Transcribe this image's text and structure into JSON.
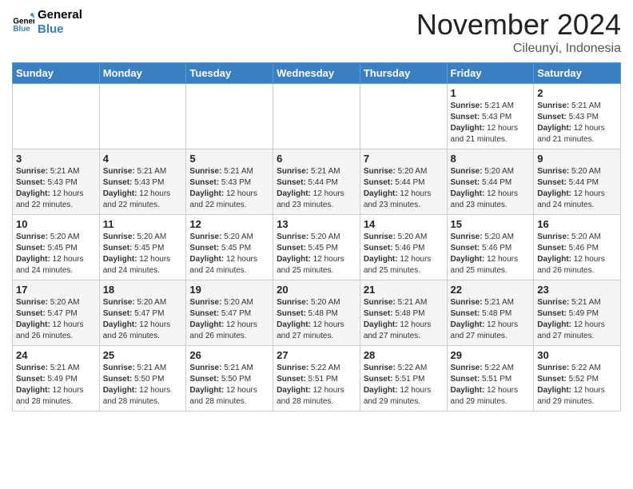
{
  "logo": {
    "line1": "General",
    "line2": "Blue"
  },
  "title": "November 2024",
  "location": "Cileunyi, Indonesia",
  "weekdays": [
    "Sunday",
    "Monday",
    "Tuesday",
    "Wednesday",
    "Thursday",
    "Friday",
    "Saturday"
  ],
  "weeks": [
    [
      {
        "day": "",
        "sunrise": "",
        "sunset": "",
        "daylight": ""
      },
      {
        "day": "",
        "sunrise": "",
        "sunset": "",
        "daylight": ""
      },
      {
        "day": "",
        "sunrise": "",
        "sunset": "",
        "daylight": ""
      },
      {
        "day": "",
        "sunrise": "",
        "sunset": "",
        "daylight": ""
      },
      {
        "day": "",
        "sunrise": "",
        "sunset": "",
        "daylight": ""
      },
      {
        "day": "1",
        "sunrise": "5:21 AM",
        "sunset": "5:43 PM",
        "daylight": "12 hours and 21 minutes."
      },
      {
        "day": "2",
        "sunrise": "5:21 AM",
        "sunset": "5:43 PM",
        "daylight": "12 hours and 21 minutes."
      }
    ],
    [
      {
        "day": "3",
        "sunrise": "5:21 AM",
        "sunset": "5:43 PM",
        "daylight": "12 hours and 22 minutes."
      },
      {
        "day": "4",
        "sunrise": "5:21 AM",
        "sunset": "5:43 PM",
        "daylight": "12 hours and 22 minutes."
      },
      {
        "day": "5",
        "sunrise": "5:21 AM",
        "sunset": "5:43 PM",
        "daylight": "12 hours and 22 minutes."
      },
      {
        "day": "6",
        "sunrise": "5:21 AM",
        "sunset": "5:44 PM",
        "daylight": "12 hours and 23 minutes."
      },
      {
        "day": "7",
        "sunrise": "5:20 AM",
        "sunset": "5:44 PM",
        "daylight": "12 hours and 23 minutes."
      },
      {
        "day": "8",
        "sunrise": "5:20 AM",
        "sunset": "5:44 PM",
        "daylight": "12 hours and 23 minutes."
      },
      {
        "day": "9",
        "sunrise": "5:20 AM",
        "sunset": "5:44 PM",
        "daylight": "12 hours and 24 minutes."
      }
    ],
    [
      {
        "day": "10",
        "sunrise": "5:20 AM",
        "sunset": "5:45 PM",
        "daylight": "12 hours and 24 minutes."
      },
      {
        "day": "11",
        "sunrise": "5:20 AM",
        "sunset": "5:45 PM",
        "daylight": "12 hours and 24 minutes."
      },
      {
        "day": "12",
        "sunrise": "5:20 AM",
        "sunset": "5:45 PM",
        "daylight": "12 hours and 24 minutes."
      },
      {
        "day": "13",
        "sunrise": "5:20 AM",
        "sunset": "5:45 PM",
        "daylight": "12 hours and 25 minutes."
      },
      {
        "day": "14",
        "sunrise": "5:20 AM",
        "sunset": "5:46 PM",
        "daylight": "12 hours and 25 minutes."
      },
      {
        "day": "15",
        "sunrise": "5:20 AM",
        "sunset": "5:46 PM",
        "daylight": "12 hours and 25 minutes."
      },
      {
        "day": "16",
        "sunrise": "5:20 AM",
        "sunset": "5:46 PM",
        "daylight": "12 hours and 26 minutes."
      }
    ],
    [
      {
        "day": "17",
        "sunrise": "5:20 AM",
        "sunset": "5:47 PM",
        "daylight": "12 hours and 26 minutes."
      },
      {
        "day": "18",
        "sunrise": "5:20 AM",
        "sunset": "5:47 PM",
        "daylight": "12 hours and 26 minutes."
      },
      {
        "day": "19",
        "sunrise": "5:20 AM",
        "sunset": "5:47 PM",
        "daylight": "12 hours and 26 minutes."
      },
      {
        "day": "20",
        "sunrise": "5:20 AM",
        "sunset": "5:48 PM",
        "daylight": "12 hours and 27 minutes."
      },
      {
        "day": "21",
        "sunrise": "5:21 AM",
        "sunset": "5:48 PM",
        "daylight": "12 hours and 27 minutes."
      },
      {
        "day": "22",
        "sunrise": "5:21 AM",
        "sunset": "5:48 PM",
        "daylight": "12 hours and 27 minutes."
      },
      {
        "day": "23",
        "sunrise": "5:21 AM",
        "sunset": "5:49 PM",
        "daylight": "12 hours and 27 minutes."
      }
    ],
    [
      {
        "day": "24",
        "sunrise": "5:21 AM",
        "sunset": "5:49 PM",
        "daylight": "12 hours and 28 minutes."
      },
      {
        "day": "25",
        "sunrise": "5:21 AM",
        "sunset": "5:50 PM",
        "daylight": "12 hours and 28 minutes."
      },
      {
        "day": "26",
        "sunrise": "5:21 AM",
        "sunset": "5:50 PM",
        "daylight": "12 hours and 28 minutes."
      },
      {
        "day": "27",
        "sunrise": "5:22 AM",
        "sunset": "5:51 PM",
        "daylight": "12 hours and 28 minutes."
      },
      {
        "day": "28",
        "sunrise": "5:22 AM",
        "sunset": "5:51 PM",
        "daylight": "12 hours and 29 minutes."
      },
      {
        "day": "29",
        "sunrise": "5:22 AM",
        "sunset": "5:51 PM",
        "daylight": "12 hours and 29 minutes."
      },
      {
        "day": "30",
        "sunrise": "5:22 AM",
        "sunset": "5:52 PM",
        "daylight": "12 hours and 29 minutes."
      }
    ]
  ],
  "labels": {
    "sunrise": "Sunrise:",
    "sunset": "Sunset:",
    "daylight": "Daylight:"
  }
}
